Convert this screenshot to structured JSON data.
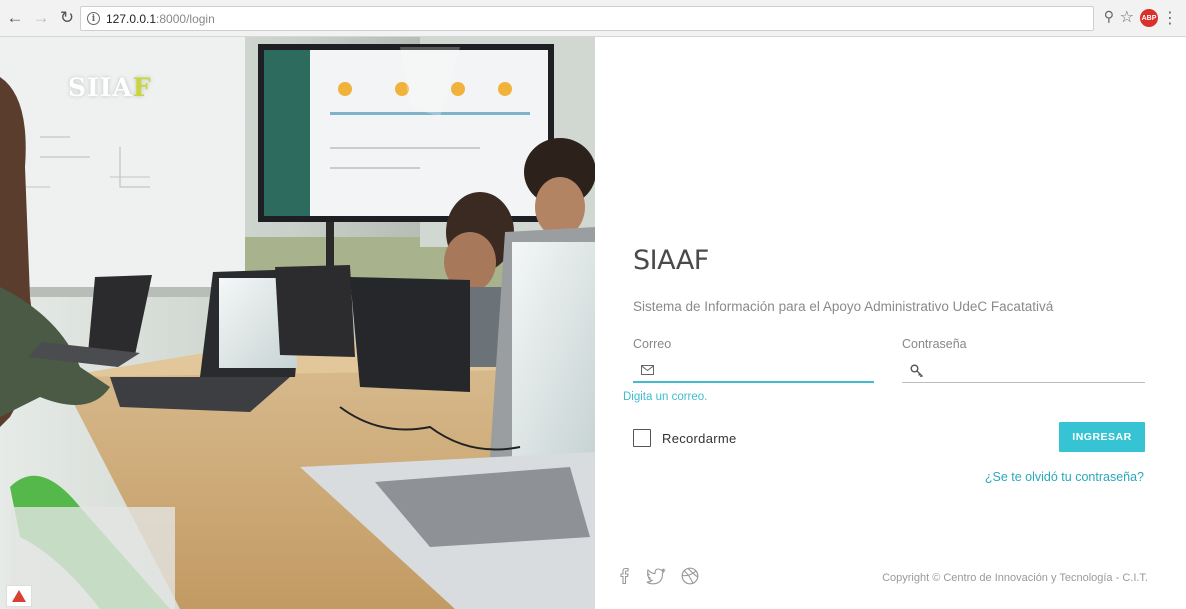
{
  "browser": {
    "url_host": "127.0.0.1",
    "url_path": ":8000/login",
    "back_icon": "arrow-left-icon",
    "forward_icon": "arrow-right-icon",
    "reload_icon": "reload-icon",
    "abp_label": "ABP"
  },
  "photo": {
    "brand_main": "SIIA",
    "brand_accent": "F",
    "accent_color": "#c8d63a"
  },
  "login": {
    "title": "SIAAF",
    "subtitle": "Sistema de Información para el Apoyo Administrativo UdeC Facatativá",
    "email_label": "Correo",
    "email_value": "",
    "email_hint": "Digita un correo.",
    "password_label": "Contraseña",
    "password_value": "",
    "remember_label": "Recordarme",
    "submit_label": "INGRESAR",
    "forgot_label": "¿Se te olvidó tu contraseña?",
    "accent_color": "#36c3d4"
  },
  "footer": {
    "social": [
      "facebook-icon",
      "twitter-icon",
      "dribbble-icon"
    ],
    "copyright": "Copyright © Centro de Innovación y Tecnología - C.I.T."
  }
}
